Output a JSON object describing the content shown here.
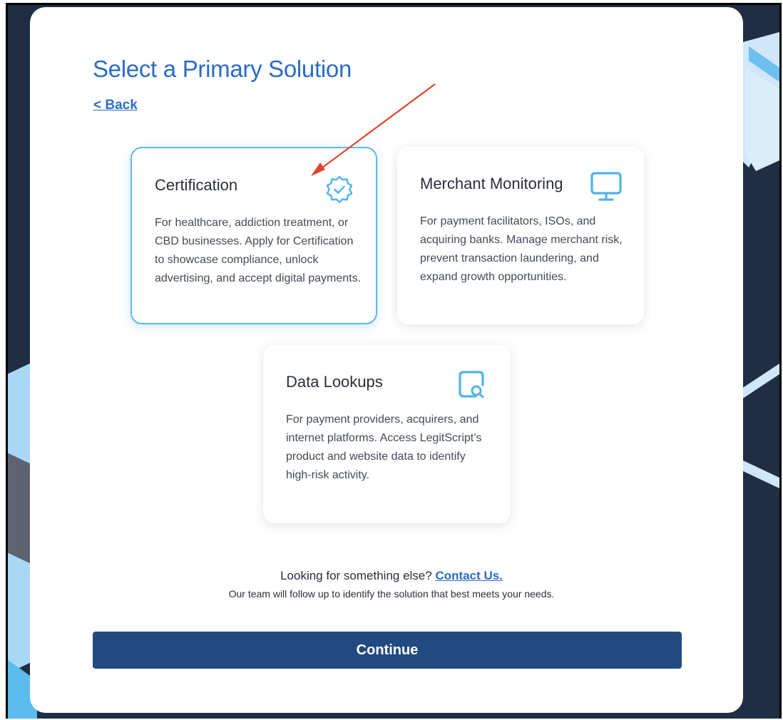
{
  "page": {
    "title": "Select a Primary Solution",
    "back_label": "< Back"
  },
  "options": [
    {
      "title": "Certification",
      "icon": "badge-check-icon",
      "selected": true,
      "description": "For healthcare, addiction treatment, or CBD businesses. Apply for Certification to showcase compliance, unlock advertising, and accept digital payments."
    },
    {
      "title": "Merchant Monitoring",
      "icon": "monitor-icon",
      "selected": false,
      "description": "For payment facilitators, ISOs, and acquiring banks. Manage merchant risk, prevent transaction laundering, and expand growth opportunities."
    },
    {
      "title": "Data Lookups",
      "icon": "document-search-icon",
      "selected": false,
      "description": "For payment providers, acquirers, and internet platforms. Access LegitScript’s product and website data to identify high-risk activity."
    }
  ],
  "footer": {
    "prompt": "Looking for something else?",
    "contact_label": "Contact Us.",
    "note": "Our team will follow up to identify the solution that best meets your needs."
  },
  "continue_label": "Continue",
  "colors": {
    "accent": "#2a6cc4",
    "icon": "#4fb3ea",
    "button": "#214a80",
    "annotation_arrow": "#e0442c"
  }
}
